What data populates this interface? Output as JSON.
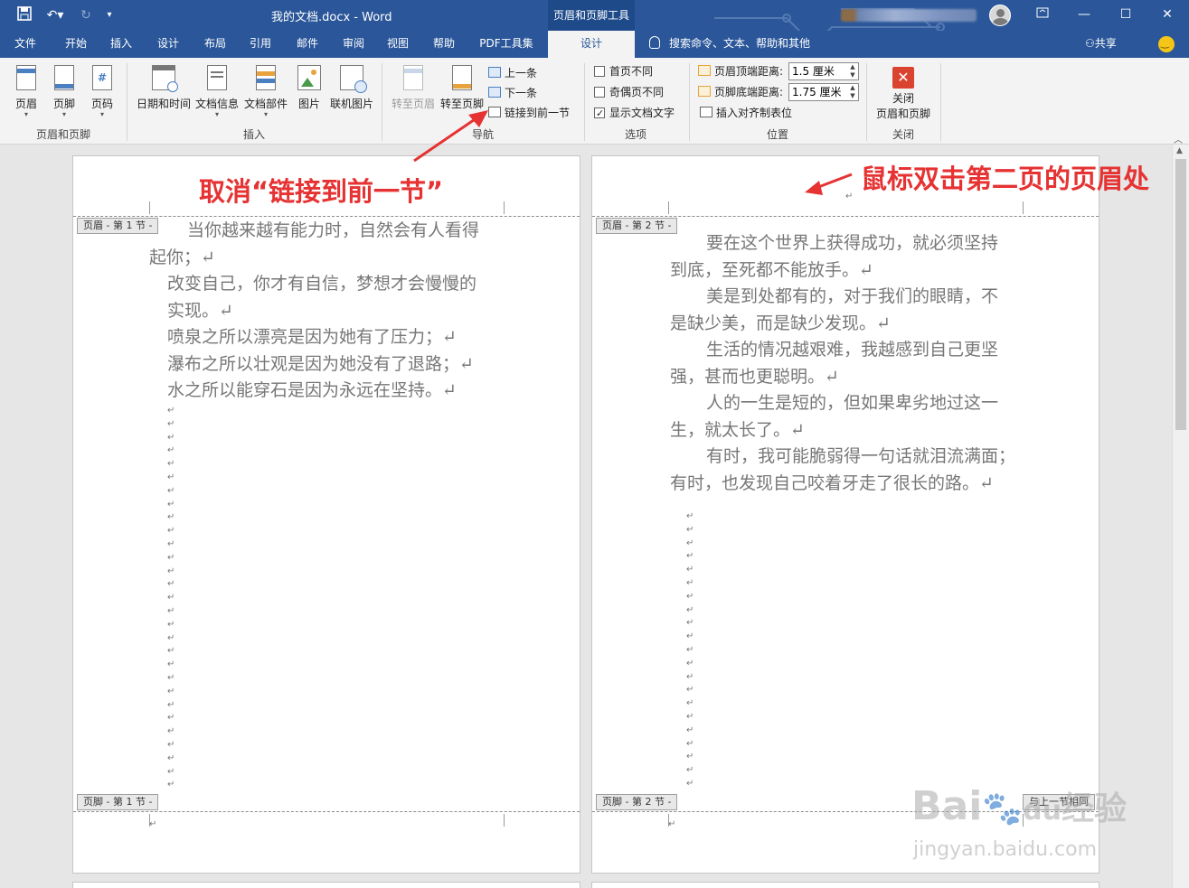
{
  "titlebar": {
    "title": "我的文档.docx  -  Word",
    "tool_tab": "页眉和页脚工具",
    "save_icon": "save-icon",
    "undo_icon": "undo-icon",
    "redo_icon": "redo-icon",
    "customize_icon": "customize-qat-icon",
    "ribbon_display_icon": "ribbon-display-icon",
    "minimize": "—",
    "maximize": "☐",
    "close": "✕"
  },
  "tabs": [
    {
      "label": "文件"
    },
    {
      "label": "开始"
    },
    {
      "label": "插入"
    },
    {
      "label": "设计"
    },
    {
      "label": "布局"
    },
    {
      "label": "引用"
    },
    {
      "label": "邮件"
    },
    {
      "label": "审阅"
    },
    {
      "label": "视图"
    },
    {
      "label": "帮助"
    },
    {
      "label": "PDF工具集"
    },
    {
      "label": "设计",
      "active": true
    }
  ],
  "search": {
    "label": "搜索命令、文本、帮助和其他",
    "icon": "lightbulb-icon"
  },
  "share": {
    "label": "共享",
    "icon": "person-icon"
  },
  "ribbon": {
    "groups": {
      "header_footer": {
        "label": "页眉和页脚",
        "buttons": [
          {
            "label": "页眉"
          },
          {
            "label": "页脚"
          },
          {
            "label": "页码"
          }
        ]
      },
      "insert": {
        "label": "插入",
        "buttons": [
          {
            "label": "日期和时间"
          },
          {
            "label": "文档信息"
          },
          {
            "label": "文档部件"
          },
          {
            "label": "图片"
          },
          {
            "label": "联机图片"
          }
        ]
      },
      "navigation": {
        "label": "导航",
        "goto_header": "转至页眉",
        "goto_footer": "转至页脚",
        "previous": "上一条",
        "next": "下一条",
        "link_previous": "链接到前一节"
      },
      "options": {
        "label": "选项",
        "first_page": "首页不同",
        "odd_even": "奇偶页不同",
        "show_text": "显示文档文字",
        "first_page_checked": false,
        "odd_even_checked": false,
        "show_text_checked": true
      },
      "position": {
        "label": "位置",
        "header_top_label": "页眉顶端距离:",
        "header_top_value": "1.5 厘米",
        "footer_bottom_label": "页脚底端距离:",
        "footer_bottom_value": "1.75 厘米",
        "insert_tab": "插入对齐制表位"
      },
      "close": {
        "label": "关闭",
        "button_line1": "关闭",
        "button_line2": "页眉和页脚",
        "icon": "close-x-icon"
      }
    }
  },
  "page1": {
    "header_tag": "页眉 - 第 1 节 -",
    "footer_tag": "页脚 - 第 1 节 -",
    "lines": [
      "当你越来越有能力时，自然会有人看得",
      "起你；↵",
      "改变自己，你才有自信，梦想才会慢慢的",
      "实现。↵",
      "喷泉之所以漂亮是因为她有了压力；↵",
      "瀑布之所以壮观是因为她没有了退路；↵",
      "水之所以能穿石是因为永远在坚持。↵"
    ],
    "empty_marks": "↵",
    "footer_mark": "↵"
  },
  "page2": {
    "header_tag": "页眉 - 第 2 节 -",
    "footer_tag": "页脚 - 第 2 节 -",
    "footer_same_tag": "与上一节相同",
    "header_mark": "↵",
    "lines": [
      "要在这个世界上获得成功，就必须坚持",
      "到底，至死都不能放手。↵",
      "美是到处都有的，对于我们的眼睛，不",
      "是缺少美，而是缺少发现。↵",
      "生活的情况越艰难，我越感到自己更坚",
      "强，甚而也更聪明。↵",
      "人的一生是短的，但如果卑劣地过这一",
      "生，就太长了。↵",
      "有时，我可能脆弱得一句话就泪流满面；",
      "有时，也发现自己咬着牙走了很长的路。↵"
    ],
    "empty_marks": "↵",
    "footer_mark": "↵"
  },
  "annotations": {
    "left": "取消“链接到前一节”",
    "right": "鼠标双击第二页的页眉处",
    "color": "#e63232"
  },
  "watermark": {
    "brand": "Bai",
    "brand_cn": "经验",
    "du": "du",
    "url": "jingyan.baidu.com"
  },
  "colors": {
    "accent": "#2b579a",
    "annotation": "#e63232"
  }
}
